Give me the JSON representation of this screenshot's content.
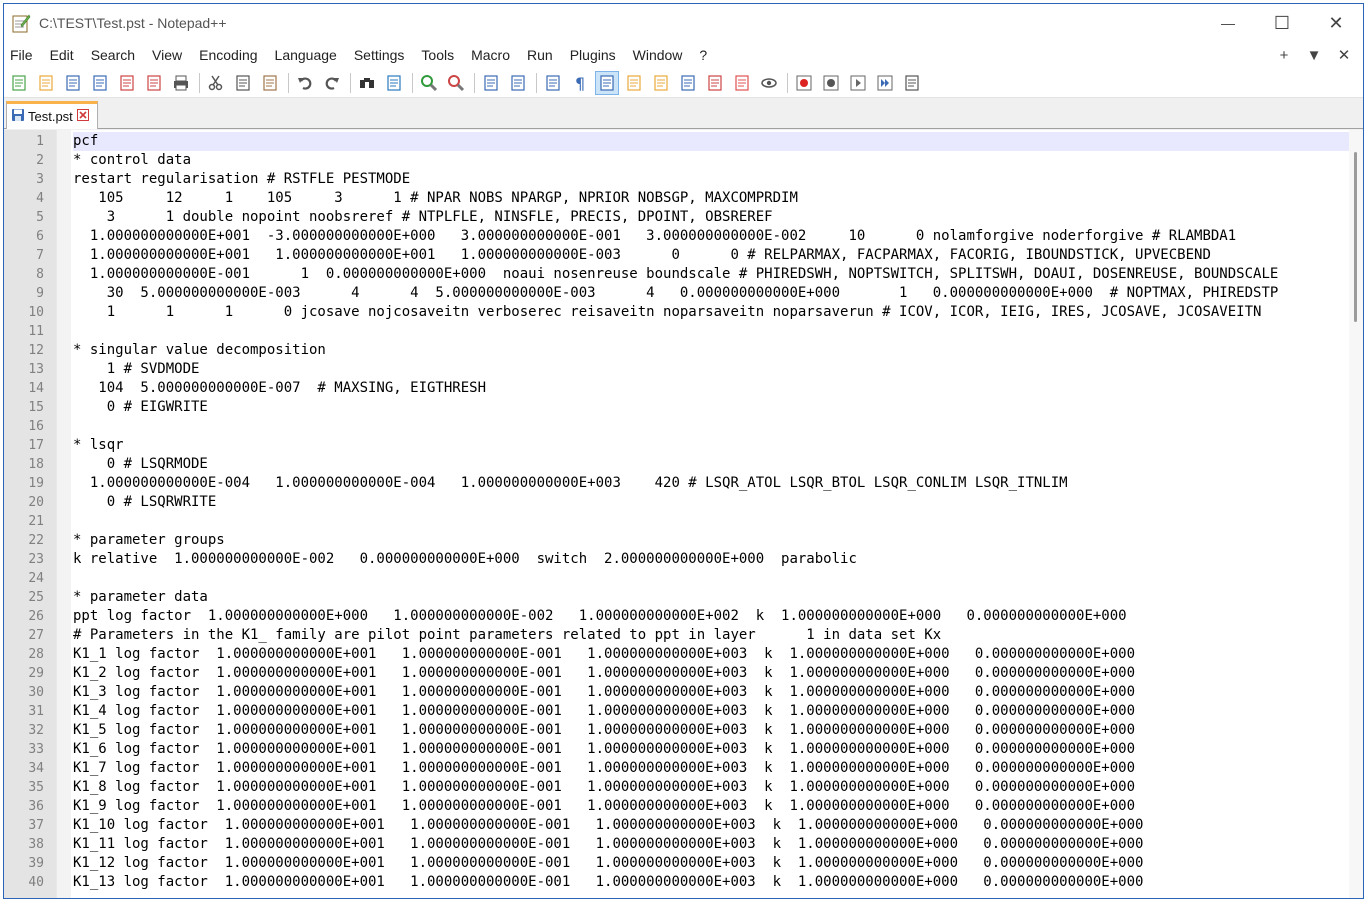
{
  "window": {
    "title": "C:\\TEST\\Test.pst - Notepad++",
    "minimize": "—",
    "maximize": "☐",
    "close": "✕"
  },
  "menu": {
    "items": [
      "File",
      "Edit",
      "Search",
      "View",
      "Encoding",
      "Language",
      "Settings",
      "Tools",
      "Macro",
      "Run",
      "Plugins",
      "Window",
      "?"
    ],
    "right": [
      "+",
      "▼",
      "✕"
    ]
  },
  "toolbar": {
    "buttons": [
      {
        "name": "new-file-icon",
        "color": "#4aa34a"
      },
      {
        "name": "open-file-icon",
        "color": "#e8a93a"
      },
      {
        "name": "save-icon",
        "color": "#3b6bb5"
      },
      {
        "name": "save-all-icon",
        "color": "#3b6bb5"
      },
      {
        "name": "close-icon",
        "color": "#c44"
      },
      {
        "name": "close-all-icon",
        "color": "#c44"
      },
      {
        "name": "print-icon",
        "color": "#555"
      },
      {
        "sep": true
      },
      {
        "name": "cut-icon",
        "color": "#555"
      },
      {
        "name": "copy-icon",
        "color": "#555"
      },
      {
        "name": "paste-icon",
        "color": "#a0764a"
      },
      {
        "sep": true
      },
      {
        "name": "undo-icon",
        "color": "#555"
      },
      {
        "name": "redo-icon",
        "color": "#555"
      },
      {
        "sep": true
      },
      {
        "name": "find-icon",
        "color": "#333"
      },
      {
        "name": "replace-icon",
        "color": "#2a7abf"
      },
      {
        "sep": true
      },
      {
        "name": "zoom-in-icon",
        "color": "#2f9a3a"
      },
      {
        "name": "zoom-out-icon",
        "color": "#c44"
      },
      {
        "sep": true
      },
      {
        "name": "sync-vertical-icon",
        "color": "#3b6bb5"
      },
      {
        "name": "sync-horizontal-icon",
        "color": "#3b6bb5"
      },
      {
        "sep": true
      },
      {
        "name": "word-wrap-icon",
        "color": "#3b6bb5"
      },
      {
        "name": "show-all-chars-icon",
        "color": "#3b6bb5"
      },
      {
        "name": "indent-guide-icon",
        "color": "#3b6bb5",
        "active": true
      },
      {
        "name": "udl-icon",
        "color": "#e8a93a"
      },
      {
        "name": "doc-map-icon",
        "color": "#e8a93a"
      },
      {
        "name": "function-list-icon",
        "color": "#3b6bb5"
      },
      {
        "name": "folder-as-workspace-icon",
        "color": "#c44"
      },
      {
        "name": "project-icon",
        "color": "#e05050"
      },
      {
        "name": "monitoring-icon",
        "color": "#555"
      },
      {
        "sep": true
      },
      {
        "name": "record-macro-icon",
        "color": "#d22"
      },
      {
        "name": "stop-record-icon",
        "color": "#555"
      },
      {
        "name": "play-macro-icon",
        "color": "#555"
      },
      {
        "name": "run-macro-multiple-icon",
        "color": "#3b6bb5"
      },
      {
        "name": "save-macro-icon",
        "color": "#555"
      }
    ]
  },
  "tab": {
    "label": "Test.pst"
  },
  "editor": {
    "current_line": 1,
    "lines": [
      "pcf",
      "* control data",
      "restart regularisation # RSTFLE PESTMODE",
      "   105     12     1    105     3      1 # NPAR NOBS NPARGP, NPRIOR NOBSGP, MAXCOMPRDIM",
      "    3      1 double nopoint noobsreref # NTPLFLE, NINSFLE, PRECIS, DPOINT, OBSREREF",
      "  1.000000000000E+001  -3.000000000000E+000   3.000000000000E-001   3.000000000000E-002     10      0 nolamforgive noderforgive # RLAMBDA1",
      "  1.000000000000E+001   1.000000000000E+001   1.000000000000E-003      0      0 # RELPARMAX, FACPARMAX, FACORIG, IBOUNDSTICK, UPVECBEND",
      "  1.000000000000E-001      1  0.000000000000E+000  noaui nosenreuse boundscale # PHIREDSWH, NOPTSWITCH, SPLITSWH, DOAUI, DOSENREUSE, BOUNDSCALE",
      "    30  5.000000000000E-003      4      4  5.000000000000E-003      4   0.000000000000E+000       1   0.000000000000E+000  # NOPTMAX, PHIREDSTP",
      "    1      1      1      0 jcosave nojcosaveitn verboserec reisaveitn noparsaveitn noparsaverun # ICOV, ICOR, IEIG, IRES, JCOSAVE, JCOSAVEITN",
      "",
      "* singular value decomposition",
      "    1 # SVDMODE",
      "   104  5.000000000000E-007  # MAXSING, EIGTHRESH",
      "    0 # EIGWRITE",
      "",
      "* lsqr",
      "    0 # LSQRMODE",
      "  1.000000000000E-004   1.000000000000E-004   1.000000000000E+003    420 # LSQR_ATOL LSQR_BTOL LSQR_CONLIM LSQR_ITNLIM",
      "    0 # LSQRWRITE",
      "",
      "* parameter groups",
      "k relative  1.000000000000E-002   0.000000000000E+000  switch  2.000000000000E+000  parabolic",
      "",
      "* parameter data",
      "ppt log factor  1.000000000000E+000   1.000000000000E-002   1.000000000000E+002  k  1.000000000000E+000   0.000000000000E+000",
      "# Parameters in the K1_ family are pilot point parameters related to ppt in layer      1 in data set Kx",
      "K1_1 log factor  1.000000000000E+001   1.000000000000E-001   1.000000000000E+003  k  1.000000000000E+000   0.000000000000E+000",
      "K1_2 log factor  1.000000000000E+001   1.000000000000E-001   1.000000000000E+003  k  1.000000000000E+000   0.000000000000E+000",
      "K1_3 log factor  1.000000000000E+001   1.000000000000E-001   1.000000000000E+003  k  1.000000000000E+000   0.000000000000E+000",
      "K1_4 log factor  1.000000000000E+001   1.000000000000E-001   1.000000000000E+003  k  1.000000000000E+000   0.000000000000E+000",
      "K1_5 log factor  1.000000000000E+001   1.000000000000E-001   1.000000000000E+003  k  1.000000000000E+000   0.000000000000E+000",
      "K1_6 log factor  1.000000000000E+001   1.000000000000E-001   1.000000000000E+003  k  1.000000000000E+000   0.000000000000E+000",
      "K1_7 log factor  1.000000000000E+001   1.000000000000E-001   1.000000000000E+003  k  1.000000000000E+000   0.000000000000E+000",
      "K1_8 log factor  1.000000000000E+001   1.000000000000E-001   1.000000000000E+003  k  1.000000000000E+000   0.000000000000E+000",
      "K1_9 log factor  1.000000000000E+001   1.000000000000E-001   1.000000000000E+003  k  1.000000000000E+000   0.000000000000E+000",
      "K1_10 log factor  1.000000000000E+001   1.000000000000E-001   1.000000000000E+003  k  1.000000000000E+000   0.000000000000E+000",
      "K1_11 log factor  1.000000000000E+001   1.000000000000E-001   1.000000000000E+003  k  1.000000000000E+000   0.000000000000E+000",
      "K1_12 log factor  1.000000000000E+001   1.000000000000E-001   1.000000000000E+003  k  1.000000000000E+000   0.000000000000E+000",
      "K1_13 log factor  1.000000000000E+001   1.000000000000E-001   1.000000000000E+003  k  1.000000000000E+000   0.000000000000E+000"
    ]
  }
}
